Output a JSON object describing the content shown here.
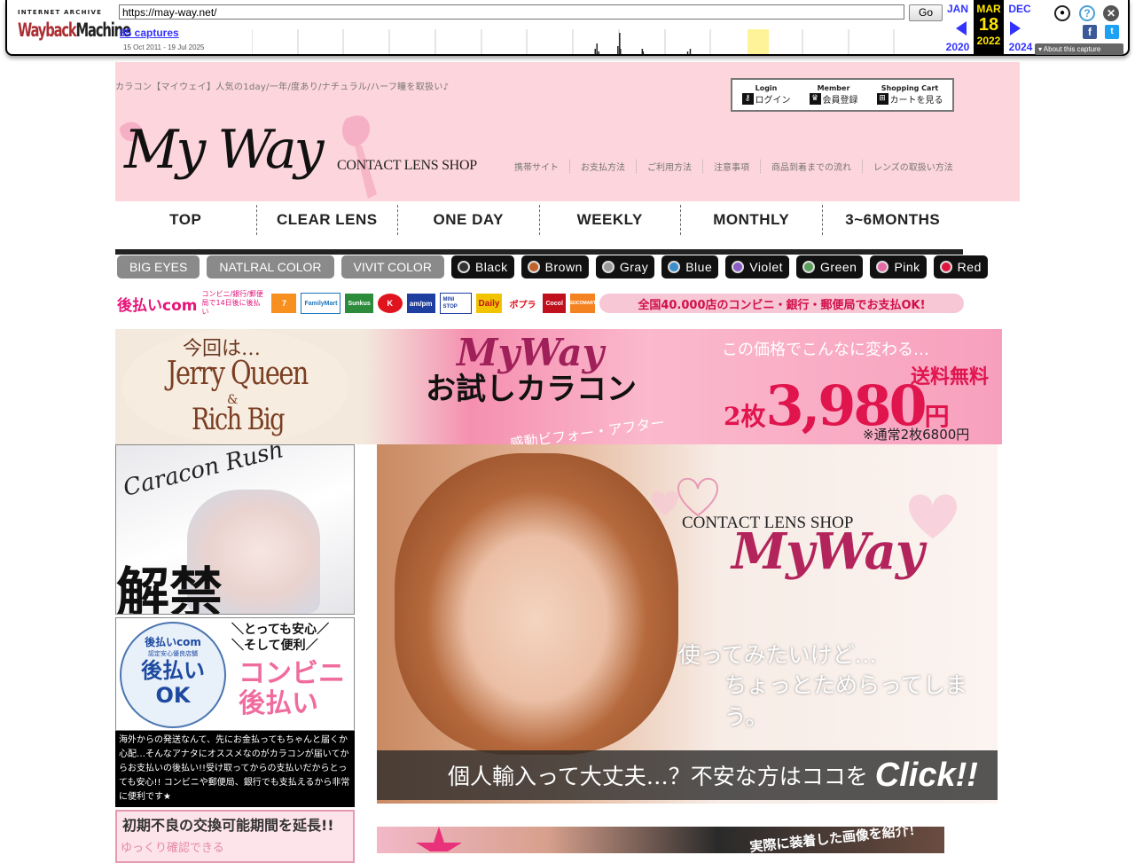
{
  "wayback": {
    "ia_label": "INTERNET ARCHIVE",
    "logo_word1": "Wayback",
    "logo_word2": "Machine",
    "url": "https://may-way.net/",
    "go": "Go",
    "captures": "85 captures",
    "range": "15 Oct 2011 - 19 Jul 2025",
    "prev_month": "JAN",
    "prev_year": "2020",
    "cur_month": "MAR",
    "cur_day": "18",
    "cur_year": "2022",
    "next_month": "DEC",
    "next_year": "2024",
    "about": "About this capture",
    "sparkline": [
      0,
      0,
      0,
      0,
      0,
      0,
      0,
      0,
      0,
      0,
      0,
      0,
      0,
      0,
      0,
      0,
      0,
      0,
      0,
      0,
      0,
      0,
      0,
      0,
      0,
      0,
      0,
      0,
      0,
      0,
      0,
      0,
      0,
      0,
      0,
      0,
      0,
      0,
      0,
      0,
      0,
      0,
      0,
      0,
      0,
      0,
      0,
      0,
      0,
      0,
      0,
      0,
      0,
      0,
      0,
      0,
      0,
      0,
      0,
      0,
      0,
      0,
      0,
      0,
      0,
      0,
      0,
      0,
      0,
      0,
      0,
      0,
      0,
      0,
      0,
      0,
      0,
      0,
      0,
      0,
      0,
      0,
      0,
      0,
      0,
      0,
      0,
      0,
      0,
      0,
      0,
      0,
      0,
      0,
      0,
      0,
      0,
      0,
      0,
      0,
      0,
      0,
      0,
      0,
      0,
      0,
      0,
      0,
      0,
      0,
      0,
      0,
      0,
      0,
      0,
      0,
      0,
      0,
      0,
      0,
      0,
      0,
      0,
      0,
      0,
      0,
      0,
      0,
      0,
      0,
      0,
      0,
      0,
      0,
      0,
      0,
      0,
      0,
      0,
      0,
      0,
      0,
      0,
      0,
      0,
      0,
      0,
      0,
      0,
      0,
      0,
      0,
      0,
      0,
      0,
      0,
      0,
      0,
      0,
      0,
      0,
      0,
      0,
      0,
      0,
      0,
      0,
      0,
      0,
      0,
      0,
      0,
      0,
      0,
      0,
      0,
      0,
      0,
      0,
      0,
      0,
      0,
      0,
      0,
      0,
      0,
      0,
      0,
      0,
      0,
      0,
      0,
      0,
      0,
      0,
      0,
      0,
      0,
      0,
      0,
      0,
      0,
      0,
      0,
      0,
      0,
      0,
      0,
      0,
      0,
      0,
      0,
      0,
      0,
      0,
      0,
      0,
      0,
      0,
      0,
      0,
      0,
      0,
      0,
      0,
      0,
      0,
      0,
      0,
      0,
      0,
      0,
      0,
      0,
      0,
      0,
      0,
      0,
      0,
      0,
      0,
      0,
      0,
      0,
      0,
      0,
      0,
      0,
      0,
      0,
      0,
      0,
      0,
      0,
      0,
      0,
      0,
      0,
      0,
      0,
      0,
      0,
      0,
      0,
      0,
      0,
      0,
      0,
      0,
      0,
      0,
      0,
      0,
      0,
      0,
      0,
      0,
      0,
      0,
      0,
      0,
      0,
      0,
      0,
      0,
      0,
      0,
      0,
      0,
      0,
      0,
      0,
      0,
      0,
      0,
      0,
      0,
      0,
      0,
      0,
      0,
      0,
      0,
      0,
      0,
      0,
      0,
      0,
      0,
      0,
      0,
      0,
      0,
      0,
      0,
      0,
      0,
      0,
      0,
      0,
      0,
      0,
      0,
      0,
      0,
      0,
      0,
      0,
      0,
      0,
      0,
      0,
      0,
      0,
      0,
      0,
      0,
      0,
      0,
      0,
      0,
      0,
      0,
      0,
      0,
      0,
      0,
      0,
      0,
      0,
      0,
      0,
      0,
      0,
      0,
      0,
      0,
      0,
      0,
      0,
      0,
      0,
      0,
      0,
      0,
      0,
      0,
      0,
      0,
      0,
      0,
      0,
      0,
      0,
      0,
      0,
      0,
      0,
      0,
      0,
      0,
      0,
      0,
      0,
      0,
      0,
      0,
      0,
      0,
      0,
      0,
      0,
      0,
      2,
      0,
      4,
      0,
      1,
      0,
      0,
      0,
      0,
      0,
      0,
      0,
      0,
      0,
      0,
      0,
      0,
      0,
      0,
      0,
      0,
      0,
      0,
      0,
      0,
      0,
      3,
      0,
      8,
      2,
      0,
      0,
      0,
      0,
      0,
      0,
      0,
      0,
      0,
      0,
      0,
      0,
      0,
      0,
      0,
      0,
      0,
      0,
      0,
      0,
      0,
      0,
      0,
      0,
      2,
      1,
      0,
      0,
      0,
      0,
      0,
      0,
      0,
      0,
      0,
      0,
      0,
      0,
      0,
      0,
      0,
      0,
      0,
      0,
      0,
      0,
      0,
      0,
      0,
      0,
      0,
      0,
      0,
      0,
      0,
      0,
      0,
      0,
      0,
      0,
      0,
      0,
      0,
      0,
      0,
      0,
      0,
      0,
      0,
      0,
      0,
      0,
      0,
      0,
      0,
      0,
      1,
      0,
      0,
      2,
      0,
      0,
      0,
      0,
      0,
      0,
      0,
      0,
      0,
      0,
      0,
      0,
      0,
      0,
      0,
      0,
      0,
      0,
      0,
      0,
      0,
      0,
      0,
      0,
      0,
      0,
      0,
      0,
      0,
      0,
      0,
      0,
      0,
      0,
      0,
      0,
      0,
      0,
      0,
      0,
      0,
      0,
      0,
      0,
      0,
      0,
      0,
      0,
      0,
      0,
      0,
      0,
      0,
      0,
      0,
      0,
      0,
      0,
      0,
      0,
      0,
      0,
      0,
      0,
      0,
      0,
      0,
      0,
      0,
      0,
      0,
      0,
      0,
      0,
      0,
      0,
      0,
      0,
      0,
      0,
      0,
      0,
      0,
      0,
      0,
      0,
      0,
      0,
      0,
      0,
      0,
      0,
      0,
      0,
      0,
      0,
      0,
      0,
      0,
      0,
      0,
      0,
      0,
      0,
      0,
      0,
      0,
      0,
      0,
      0,
      0,
      0,
      0,
      0,
      0,
      0,
      0,
      0,
      0,
      0,
      0,
      0,
      0,
      0,
      0,
      0,
      0,
      0,
      0,
      0,
      0,
      0,
      0,
      0,
      0,
      0,
      0,
      0,
      0,
      0,
      0,
      0,
      0,
      0,
      0,
      0,
      0,
      0,
      0,
      0,
      0,
      0,
      0,
      0,
      0,
      0,
      0,
      0,
      0,
      0,
      0,
      0,
      0,
      0,
      0,
      0,
      0,
      0,
      0,
      0,
      0,
      0,
      0,
      0,
      0,
      0,
      0,
      0,
      0,
      0,
      0,
      0,
      0,
      0,
      0,
      0,
      0,
      0,
      0,
      0,
      0,
      0,
      0,
      0,
      0,
      0,
      0,
      0,
      0,
      0,
      0,
      0,
      0,
      0,
      0,
      0,
      0,
      0,
      0,
      0,
      0,
      0,
      0,
      0,
      0,
      0,
      0,
      0,
      0,
      0,
      0,
      0,
      0,
      0,
      0,
      0,
      0,
      0,
      0,
      0,
      0,
      0,
      0,
      0,
      0,
      0,
      0,
      0,
      0,
      0,
      0,
      0,
      0,
      0,
      0,
      0,
      0,
      0,
      0,
      0,
      0,
      0,
      0,
      0,
      0,
      0,
      0,
      0,
      0,
      0,
      0,
      0,
      0,
      0,
      0,
      0,
      0,
      0,
      0,
      0,
      0,
      0,
      0,
      0,
      0,
      0,
      0,
      0,
      0,
      0,
      0,
      0,
      0,
      0,
      0,
      0
    ]
  },
  "site": {
    "tagline": "カラコン【マイウェイ】人気の1day/一年/度あり/ナチュラル/ハーフ瞳を取扱い♪",
    "account": [
      {
        "en": "Login",
        "jp": "ログイン",
        "icon": "key-icon"
      },
      {
        "en": "Member",
        "jp": "会員登録",
        "icon": "crown-icon"
      },
      {
        "en": "Shopping Cart",
        "jp": "カートを見る",
        "icon": "cart-icon"
      }
    ],
    "logo_script": "My Way",
    "logo_sub": "CONTACT LENS SHOP",
    "top_links": [
      "携帯サイト",
      "お支払方法",
      "ご利用方法",
      "注意事項",
      "商品到着までの流れ",
      "レンズの取扱い方法"
    ],
    "nav": [
      "TOP",
      "CLEAR LENS",
      "ONE DAY",
      "WEEKLY",
      "MONTHLY",
      "3~6MONTHS"
    ],
    "categories": [
      "BIG EYES",
      "NATLRAL COLOR",
      "VIVIT COLOR"
    ],
    "colors": [
      {
        "label": "Black",
        "hex": "#333333"
      },
      {
        "label": "Brown",
        "hex": "#c1622b"
      },
      {
        "label": "Gray",
        "hex": "#9a9a9a"
      },
      {
        "label": "Blue",
        "hex": "#3d8ec9"
      },
      {
        "label": "Violet",
        "hex": "#8a5cc4"
      },
      {
        "label": "Green",
        "hex": "#5aa05a"
      },
      {
        "label": "Pink",
        "hex": "#e26aa5"
      },
      {
        "label": "Red",
        "hex": "#e0143c"
      }
    ],
    "payment": {
      "brand": "後払いcom",
      "brand_sub": "コンビニ/銀行/郵便局で14日後に後払い",
      "stores": [
        "7",
        "FamilyMart",
        "Sunkus",
        "K",
        "am/pm",
        "MINI STOP",
        "Daily",
        "ポプラ",
        "Cocol",
        "SEICOMART"
      ],
      "message": "全国40.000店のコンビニ・銀行・郵便局でお支払OK!"
    },
    "banner": {
      "konkai": "今回は…",
      "product1": "Jerry Queen",
      "amp": "&",
      "product2": "Rich Big",
      "brand": "MyWay",
      "title": "お試しカラコン",
      "sub": "感動ビフォー・アフター",
      "catch": "この価格でこんなに変わる…",
      "shipping": "送料無料",
      "qty": "2枚",
      "price": "3,980",
      "yen": "円",
      "regular": "※通常2枚6800円"
    },
    "rush": {
      "title": "Caracon Rush",
      "kanji": "解禁"
    },
    "conv": {
      "seal_brand": "後払いcom",
      "seal_sub": "認定安心優良店舗",
      "seal_big": "後払い",
      "seal_ok": "OK",
      "anshin1": "＼とっても安心／",
      "anshin2": "＼そして便利／",
      "konbini": "コンビニ",
      "atobarai": "後払い"
    },
    "conv_text": "海外からの発送なんて、先にお金払ってもちゃんと届くか心配…そんなアナタにオススメなのがカラコンが届いてからお支払いの後払い!!受け取ってからの支払いだからとっても安心!! コンビニや郵便局、銀行でも支払えるから非常に便利です★",
    "extend": {
      "head": "初期不良の交換可能期間を延長!!",
      "sub": "ゆっくり確認できる"
    },
    "hero": {
      "cls": "CONTACT LENS SHOP",
      "brand": "MyWay",
      "q1": "使ってみたいけど…",
      "q2": "ちょっとためらってしまう。",
      "bar": "個人輸入って大丈夫…？不安な方はココを",
      "click": "Click!!"
    },
    "strip": "実際に装着した画像を紹介！"
  }
}
